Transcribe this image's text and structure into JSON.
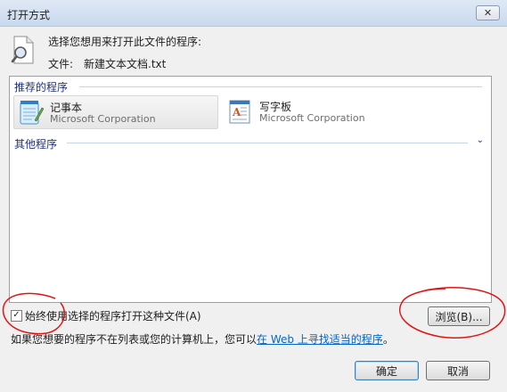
{
  "window": {
    "title": "打开方式",
    "close_label": "✕"
  },
  "header": {
    "prompt": "选择您想用来打开此文件的程序:",
    "file_label": "文件:",
    "file_name": "新建文本文档.txt"
  },
  "recommended": {
    "label": "推荐的程序",
    "programs": [
      {
        "name": "记事本",
        "company": "Microsoft Corporation",
        "selected": true
      },
      {
        "name": "写字板",
        "company": "Microsoft Corporation",
        "selected": false
      }
    ]
  },
  "other": {
    "label": "其他程序",
    "chevron": "⌄"
  },
  "options": {
    "always_use_label": "始终使用选择的程序打开这种文件(A)",
    "always_use_checked": true,
    "check_mark": "✓"
  },
  "browse_label": "浏览(B)...",
  "hint": {
    "prefix": "如果您想要的程序不在列表或您的计算机上，您可以",
    "link": "在 Web 上寻找适当的程序",
    "suffix": "。"
  },
  "ok_label": "确定",
  "cancel_label": "取消",
  "colors": {
    "group_header": "#1e3287",
    "link": "#0066cc",
    "annotation": "#e01414"
  }
}
